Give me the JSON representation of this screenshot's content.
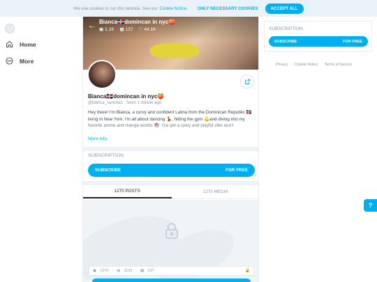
{
  "cookie": {
    "message": "We use cookies to run this website. See our",
    "link": "Cookie Notice.",
    "necessary_label": "ONLY NECESSARY COOKIES",
    "accept_label": "ACCEPT ALL"
  },
  "sidebar": {
    "items": [
      {
        "label": "Home",
        "icon": "home-icon"
      },
      {
        "label": "More",
        "icon": "more-icon"
      }
    ]
  },
  "header": {
    "name": "Bianca🇩🇴domincan in nyc🍑",
    "stats": {
      "photos": "1.1K",
      "videos": "137",
      "likes": "44.1K"
    }
  },
  "profile": {
    "name": "Bianca🇩🇴domincan in nyc🍑",
    "handle": "@bianca_sanchez",
    "separator": "·",
    "seen": "Seen 1 minute ago",
    "bio": "Hey there! I'm Bianca, a curvy and confident Latina from the Dominican Republic 🇩🇴 living in New York. I'm all about dancing 💃, hitting the gym 💪and diving into my favorite anime and manga worlds 📚. I've got a spicy and playful vibe and I",
    "more_info": "More info"
  },
  "subscription": {
    "label": "SUBSCRIPTION",
    "button_left": "SUBSCRIBE",
    "button_right": "FOR FREE"
  },
  "tabs": [
    {
      "label": "1270 POSTS",
      "active": true
    },
    {
      "label": "1270 MEDIA",
      "active": false
    }
  ],
  "locked_counts": {
    "photos": "1270",
    "images": "1133",
    "videos": "137"
  },
  "right": {
    "label": "SUBSCRIPTION",
    "button_left": "SUBSCRIBE",
    "button_right": "FOR FREE",
    "footer": [
      "Privacy",
      "Cookie Notice",
      "Terms of Service"
    ]
  },
  "colors": {
    "accent": "#00aff0",
    "muted": "#8a96a3"
  }
}
